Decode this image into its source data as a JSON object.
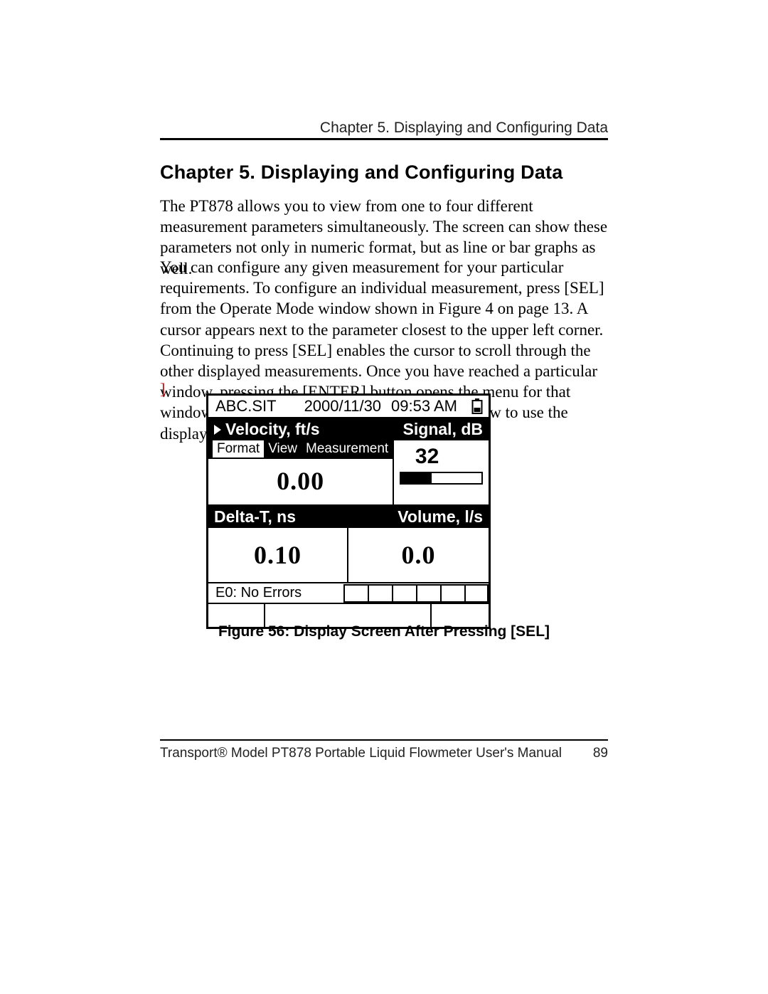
{
  "running_head": "Chapter 5. Displaying and Configuring Data",
  "chapter_title": "Chapter 5.  Displaying and Configuring Data",
  "para1": "The PT878 allows you to view from one to four different measurement parameters simultaneously. The screen can show these parameters not only in numeric format, but as line or bar graphs as well.",
  "para2": "You can configure any given measurement for your particular requirements. To configure an individual measurement, press [SEL] from the Operate Mode window shown in Figure 4 on page 13. A cursor appears next to the parameter closest to the upper left corner. Continuing to press [SEL] enables the cursor to scroll through the other displayed measurements. Once you have reached a particular window, pressing the [ENTER] button opens the menu for that window, as shown in Figure 56 below. To learn how to use the display window menu, see page 90 to page 94.",
  "stray": "]",
  "device": {
    "file": "ABC.SIT",
    "date": "2000/11/30",
    "time": "09:53 AM",
    "menu": {
      "format": "Format",
      "view": "View",
      "meas": "Measurement"
    },
    "q1": {
      "label": "Velocity, ft/s",
      "value": "0.00"
    },
    "q2": {
      "label": "Signal, dB",
      "value": "32",
      "bar_pct": 38
    },
    "q3": {
      "label": "Delta-T, ns",
      "value": "0.10"
    },
    "q4": {
      "label": "Volume, l/s",
      "value": "0.0"
    },
    "error": "E0: No Errors"
  },
  "figure_caption": "Figure 56: Display Screen After Pressing [SEL]",
  "footer_left": "Transport® Model PT878 Portable Liquid Flowmeter User's Manual",
  "footer_right": "89"
}
